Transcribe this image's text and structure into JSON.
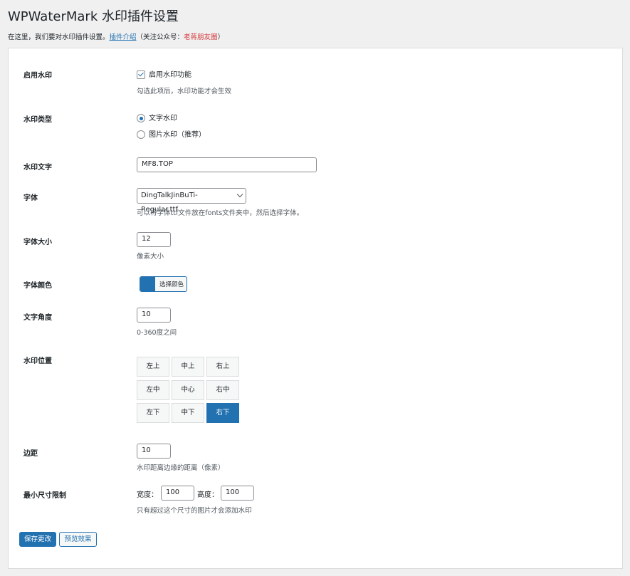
{
  "page": {
    "title": "WPWaterMark 水印插件设置",
    "intro": "在这里，我们要对水印插件设置。",
    "intro_link": "插件介绍",
    "intro_note_open": "（关注公众号：",
    "intro_note_name": "老蒋朋友圈",
    "intro_note_close": "）"
  },
  "settings": {
    "enable": {
      "label": "启用水印",
      "checkbox_label": "启用水印功能",
      "checked": true,
      "desc": "勾选此项后，水印功能才会生效"
    },
    "type": {
      "label": "水印类型",
      "options": [
        "文字水印",
        "图片水印（推荐）"
      ],
      "selected": "文字水印"
    },
    "text": {
      "label": "水印文字",
      "value": "MF8.TOP"
    },
    "font": {
      "label": "字体",
      "value": "DingTalkJinBuTi-Regular.ttf",
      "desc": "可以将字体ttf文件放在fonts文件夹中，然后选择字体。"
    },
    "font_size": {
      "label": "字体大小",
      "value": "12",
      "desc": "像素大小"
    },
    "font_color": {
      "label": "字体颜色",
      "button": "选择颜色",
      "color": "#2271b1"
    },
    "angle": {
      "label": "文字角度",
      "value": "10",
      "desc": "0-360度之间"
    },
    "position": {
      "label": "水印位置",
      "grid": [
        [
          "左上",
          "中上",
          "右上"
        ],
        [
          "左中",
          "中心",
          "右中"
        ],
        [
          "左下",
          "中下",
          "右下"
        ]
      ],
      "selected": "右下"
    },
    "margin": {
      "label": "边距",
      "value": "10",
      "desc": "水印距离边缘的距离（像素）"
    },
    "min_size": {
      "label": "最小尺寸限制",
      "width_label": "宽度：",
      "width": "100",
      "height_label": "高度：",
      "height": "100",
      "desc": "只有超过这个尺寸的图片才会添加水印"
    }
  },
  "actions": {
    "save": "保存更改",
    "preview": "预览效果"
  },
  "colors": {
    "accent": "#2271b1",
    "link": "#2271b1",
    "highlight": "#d63638"
  }
}
